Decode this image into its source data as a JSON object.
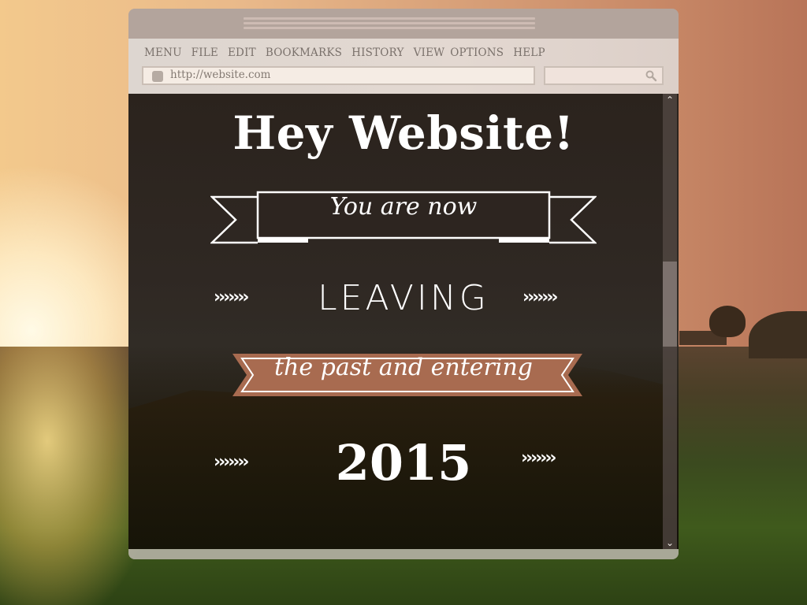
{
  "browser": {
    "menu": [
      "MENU",
      "FILE",
      "EDIT",
      "BOOKMARKS",
      "HISTORY",
      "VIEW",
      "OPTIONS",
      "HELP"
    ],
    "address": "http://website.com",
    "search_value": "",
    "icons": {
      "favicon": "favicon-placeholder-icon",
      "search": "search-icon",
      "scroll_up": "chevron-up-icon",
      "scroll_down": "chevron-down-icon"
    },
    "scroll_position": 0.45
  },
  "poster": {
    "headline": "Hey Website!",
    "ribbon_top": "You are now",
    "middle_word": "LEAVING",
    "ribbon_bottom": "the past and entering",
    "year": "2015",
    "arrows": "»»»»",
    "colors": {
      "text": "#ffffff",
      "ribbon_accent": "#a86b50",
      "content_background": "#2c2520"
    }
  }
}
